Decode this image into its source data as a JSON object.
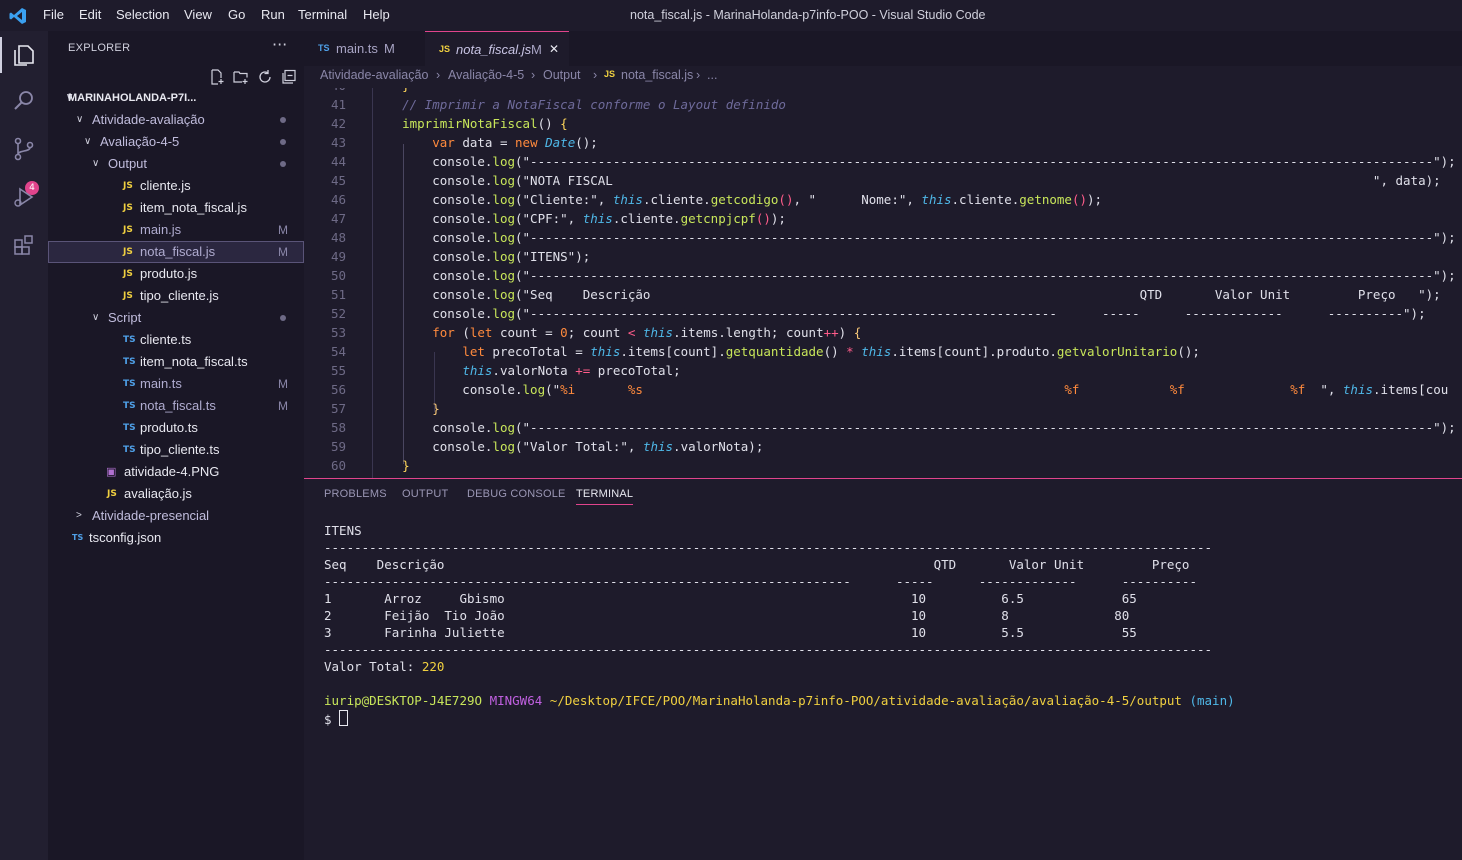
{
  "menu": [
    "File",
    "Edit",
    "Selection",
    "View",
    "Go",
    "Run",
    "Terminal",
    "Help"
  ],
  "window_title": "nota_fiscal.js - MarinaHolanda-p7info-POO - Visual Studio Code",
  "activity_bar": {
    "scm_badge": "4"
  },
  "sidebar": {
    "title": "EXPLORER",
    "more": "···",
    "rows": [
      {
        "label": "MARINAHOLANDA-P7I...",
        "indent": 0,
        "type": "root",
        "chev": "∨"
      },
      {
        "label": "Atividade-avaliação",
        "indent": 1,
        "type": "folder",
        "chev": "∨",
        "dot": true
      },
      {
        "label": "Avaliação-4-5",
        "indent": 2,
        "type": "folder",
        "chev": "∨",
        "dot": true
      },
      {
        "label": "Output",
        "indent": 3,
        "type": "folder",
        "chev": "∨",
        "dot": true
      },
      {
        "label": "cliente.js",
        "indent": 4,
        "type": "js"
      },
      {
        "label": "item_nota_fiscal.js",
        "indent": 4,
        "type": "js"
      },
      {
        "label": "main.js",
        "indent": 4,
        "type": "js",
        "badge": "M"
      },
      {
        "label": "nota_fiscal.js",
        "indent": 4,
        "type": "js",
        "badge": "M",
        "selected": true
      },
      {
        "label": "produto.js",
        "indent": 4,
        "type": "js"
      },
      {
        "label": "tipo_cliente.js",
        "indent": 4,
        "type": "js"
      },
      {
        "label": "Script",
        "indent": 3,
        "type": "folder",
        "chev": "∨",
        "dot": true
      },
      {
        "label": "cliente.ts",
        "indent": 4,
        "type": "ts"
      },
      {
        "label": "item_nota_fiscal.ts",
        "indent": 4,
        "type": "ts"
      },
      {
        "label": "main.ts",
        "indent": 4,
        "type": "ts",
        "badge": "M"
      },
      {
        "label": "nota_fiscal.ts",
        "indent": 4,
        "type": "ts",
        "badge": "M"
      },
      {
        "label": "produto.ts",
        "indent": 4,
        "type": "ts"
      },
      {
        "label": "tipo_cliente.ts",
        "indent": 4,
        "type": "ts"
      },
      {
        "label": "atividade-4.PNG",
        "indent": 3,
        "type": "img"
      },
      {
        "label": "avaliação.js",
        "indent": 2,
        "type": "js"
      },
      {
        "label": "Atividade-presencial",
        "indent": 1,
        "type": "folder",
        "chev": ">"
      },
      {
        "label": "tsconfig.json",
        "indent": 1,
        "type": "tsconfig"
      }
    ]
  },
  "tabs": [
    {
      "icon": "TS",
      "label": "main.ts",
      "badge": "M"
    },
    {
      "icon": "JS",
      "label": "nota_fiscal.js",
      "badge": "M",
      "close": "✕"
    }
  ],
  "breadcrumb": [
    "Atividade-avaliação",
    "Avaliação-4-5",
    "Output",
    "nota_fiscal.js",
    "..."
  ],
  "editor": {
    "lines": [
      {
        "n": "40",
        "t": [
          [
            "    ",
            ""
          ],
          [
            "}",
            "c-brace"
          ]
        ]
      },
      {
        "n": "41",
        "t": [
          [
            "    ",
            ""
          ],
          [
            "// Imprimir a NotaFiscal conforme o Layout definido",
            "c-com"
          ]
        ]
      },
      {
        "n": "42",
        "t": [
          [
            "    ",
            ""
          ],
          [
            "imprimirNotaFiscal",
            "c-fn"
          ],
          [
            "() ",
            ""
          ],
          [
            "{",
            "c-brace"
          ]
        ]
      },
      {
        "n": "43",
        "t": [
          [
            "        ",
            ""
          ],
          [
            "var",
            "c-kw"
          ],
          [
            " data = ",
            ""
          ],
          [
            "new",
            "c-kw"
          ],
          [
            " ",
            ""
          ],
          [
            "Date",
            "c-type"
          ],
          [
            "();",
            ""
          ]
        ]
      },
      {
        "n": "44",
        "t": [
          [
            "        console.",
            ""
          ],
          [
            "log",
            "c-fn"
          ],
          [
            "(\"------------------------------------------------------------------------------------------------------------------------\");",
            ""
          ]
        ]
      },
      {
        "n": "45",
        "t": [
          [
            "        console.",
            ""
          ],
          [
            "log",
            "c-fn"
          ],
          [
            "(\"NOTA FISCAL                                                                                                     \", data);",
            ""
          ]
        ]
      },
      {
        "n": "46",
        "t": [
          [
            "        console.",
            ""
          ],
          [
            "log",
            "c-fn"
          ],
          [
            "(\"Cliente:\", ",
            ""
          ],
          [
            "this",
            "c-this"
          ],
          [
            ".cliente.",
            ""
          ],
          [
            "getcodigo",
            "c-fn"
          ],
          [
            "()",
            "c-par"
          ],
          [
            ", \"      Nome:\", ",
            ""
          ],
          [
            "this",
            "c-this"
          ],
          [
            ".cliente.",
            ""
          ],
          [
            "getnome",
            "c-fn"
          ],
          [
            "()",
            "c-par"
          ],
          [
            ");",
            ""
          ]
        ]
      },
      {
        "n": "47",
        "t": [
          [
            "        console.",
            ""
          ],
          [
            "log",
            "c-fn"
          ],
          [
            "(\"CPF:\", ",
            ""
          ],
          [
            "this",
            "c-this"
          ],
          [
            ".cliente.",
            ""
          ],
          [
            "getcnpjcpf",
            "c-fn"
          ],
          [
            "()",
            "c-par"
          ],
          [
            ");",
            ""
          ]
        ]
      },
      {
        "n": "48",
        "t": [
          [
            "        console.",
            ""
          ],
          [
            "log",
            "c-fn"
          ],
          [
            "(\"------------------------------------------------------------------------------------------------------------------------\");",
            ""
          ]
        ]
      },
      {
        "n": "49",
        "t": [
          [
            "        console.",
            ""
          ],
          [
            "log",
            "c-fn"
          ],
          [
            "(\"ITENS\");",
            ""
          ]
        ]
      },
      {
        "n": "50",
        "t": [
          [
            "        console.",
            ""
          ],
          [
            "log",
            "c-fn"
          ],
          [
            "(\"------------------------------------------------------------------------------------------------------------------------\");",
            ""
          ]
        ]
      },
      {
        "n": "51",
        "t": [
          [
            "        console.",
            ""
          ],
          [
            "log",
            "c-fn"
          ],
          [
            "(\"Seq    Descrição                                                                 QTD       Valor Unit         Preço   \");",
            ""
          ]
        ]
      },
      {
        "n": "52",
        "t": [
          [
            "        console.",
            ""
          ],
          [
            "log",
            "c-fn"
          ],
          [
            "(\"----------------------------------------------------------------------      -----      -------------      ----------\");",
            ""
          ]
        ]
      },
      {
        "n": "53",
        "t": [
          [
            "        ",
            ""
          ],
          [
            "for",
            "c-kw"
          ],
          [
            " (",
            ""
          ],
          [
            "let",
            "c-kw"
          ],
          [
            " count = ",
            ""
          ],
          [
            "0",
            "c-num"
          ],
          [
            "; count ",
            ""
          ],
          [
            "<",
            "c-op"
          ],
          [
            " ",
            ""
          ],
          [
            "this",
            "c-this"
          ],
          [
            ".items.length; count",
            ""
          ],
          [
            "++",
            "c-op"
          ],
          [
            ") ",
            ""
          ],
          [
            "{",
            "c-pl"
          ]
        ]
      },
      {
        "n": "54",
        "t": [
          [
            "            ",
            ""
          ],
          [
            "let",
            "c-kw"
          ],
          [
            " precoTotal = ",
            ""
          ],
          [
            "this",
            "c-this"
          ],
          [
            ".items[count].",
            ""
          ],
          [
            "getquantidade",
            "c-fn"
          ],
          [
            "() ",
            ""
          ],
          [
            "*",
            "c-op"
          ],
          [
            " ",
            ""
          ],
          [
            "this",
            "c-this"
          ],
          [
            ".items[count].produto.",
            ""
          ],
          [
            "getvalorUnitario",
            "c-fn"
          ],
          [
            "();",
            ""
          ]
        ]
      },
      {
        "n": "55",
        "t": [
          [
            "            ",
            ""
          ],
          [
            "this",
            "c-this"
          ],
          [
            ".valorNota ",
            ""
          ],
          [
            "+=",
            "c-op"
          ],
          [
            " precoTotal;",
            ""
          ]
        ]
      },
      {
        "n": "56",
        "t": [
          [
            "            console.",
            ""
          ],
          [
            "log",
            "c-fn"
          ],
          [
            "(\"",
            ""
          ],
          [
            "%i",
            "c-num"
          ],
          [
            "       ",
            ""
          ],
          [
            "%s",
            "c-num"
          ],
          [
            "                                                        ",
            ""
          ],
          [
            "%f",
            "c-num"
          ],
          [
            "            ",
            ""
          ],
          [
            "%f",
            "c-num"
          ],
          [
            "              ",
            ""
          ],
          [
            "%f",
            "c-num"
          ],
          [
            "  \", ",
            ""
          ],
          [
            "this",
            "c-this"
          ],
          [
            ".items[cou",
            ""
          ]
        ]
      },
      {
        "n": "57",
        "t": [
          [
            "        ",
            ""
          ],
          [
            "}",
            "c-pl"
          ]
        ]
      },
      {
        "n": "58",
        "t": [
          [
            "        console.",
            ""
          ],
          [
            "log",
            "c-fn"
          ],
          [
            "(\"------------------------------------------------------------------------------------------------------------------------\");",
            ""
          ]
        ]
      },
      {
        "n": "59",
        "t": [
          [
            "        console.",
            ""
          ],
          [
            "log",
            "c-fn"
          ],
          [
            "(\"Valor Total:\", ",
            ""
          ],
          [
            "this",
            "c-this"
          ],
          [
            ".valorNota);",
            ""
          ]
        ]
      },
      {
        "n": "60",
        "t": [
          [
            "    ",
            ""
          ],
          [
            "}",
            "c-brace"
          ]
        ]
      }
    ]
  },
  "panel": {
    "tabs": [
      "PROBLEMS",
      "OUTPUT",
      "DEBUG CONSOLE",
      "TERMINAL"
    ],
    "terminal": [
      "ITENS",
      "----------------------------------------------------------------------------------------------------------------------",
      "Seq    Descrição                                                                 QTD       Valor Unit         Preço",
      "----------------------------------------------------------------------      -----      -------------      ----------",
      "1       Arroz     Gbismo                                                      10          6.5             65",
      "2       Feijão  Tio João                                                      10          8              80",
      "3       Farinha Juliette                                                      10          5.5             55",
      "----------------------------------------------------------------------------------------------------------------------",
      "Valor Total: 220"
    ],
    "prompt_user": "iurip@DESKTOP-J4E729O",
    "prompt_env": "MINGW64",
    "prompt_path": "~/Desktop/IFCE/POO/MarinaHolanda-p7info-POO/atividade-avaliação/avaliação-4-5/output",
    "prompt_branch": "(main)",
    "prompt_symbol": "$"
  }
}
